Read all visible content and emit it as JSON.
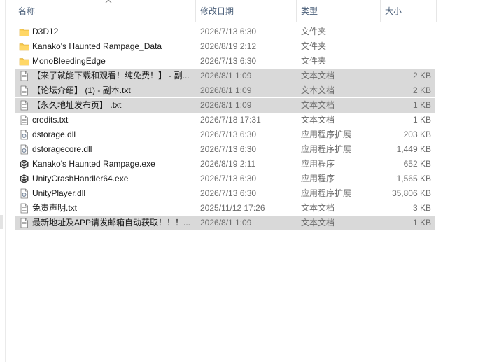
{
  "columns": {
    "name": "名称",
    "date": "修改日期",
    "type": "类型",
    "size": "大小"
  },
  "files": [
    {
      "name": "D3D12",
      "date": "2026/7/13 6:30",
      "type": "文件夹",
      "size": "",
      "icon": "folder-icon",
      "selected": false
    },
    {
      "name": "Kanako's Haunted Rampage_Data",
      "date": "2026/8/19 2:12",
      "type": "文件夹",
      "size": "",
      "icon": "folder-icon",
      "selected": false
    },
    {
      "name": "MonoBleedingEdge",
      "date": "2026/7/13 6:30",
      "type": "文件夹",
      "size": "",
      "icon": "folder-icon",
      "selected": false
    },
    {
      "name": "【来了就能下载和观看！纯免费！】 - 副...",
      "date": "2026/8/1 1:09",
      "type": "文本文档",
      "size": "2 KB",
      "icon": "text-file-icon",
      "selected": true
    },
    {
      "name": "【论坛介绍】 (1) - 副本.txt",
      "date": "2026/8/1 1:09",
      "type": "文本文档",
      "size": "2 KB",
      "icon": "text-file-icon",
      "selected": true
    },
    {
      "name": "【永久地址发布页】 .txt",
      "date": "2026/8/1 1:09",
      "type": "文本文档",
      "size": "1 KB",
      "icon": "text-file-icon",
      "selected": true
    },
    {
      "name": "credits.txt",
      "date": "2026/7/18 17:31",
      "type": "文本文档",
      "size": "1 KB",
      "icon": "text-file-icon",
      "selected": false
    },
    {
      "name": "dstorage.dll",
      "date": "2026/7/13 6:30",
      "type": "应用程序扩展",
      "size": "203 KB",
      "icon": "dll-file-icon",
      "selected": false
    },
    {
      "name": "dstoragecore.dll",
      "date": "2026/7/13 6:30",
      "type": "应用程序扩展",
      "size": "1,449 KB",
      "icon": "dll-file-icon",
      "selected": false
    },
    {
      "name": "Kanako's Haunted Rampage.exe",
      "date": "2026/8/19 2:11",
      "type": "应用程序",
      "size": "652 KB",
      "icon": "unity-icon",
      "selected": false
    },
    {
      "name": "UnityCrashHandler64.exe",
      "date": "2026/7/13 6:30",
      "type": "应用程序",
      "size": "1,565 KB",
      "icon": "unity-icon",
      "selected": false
    },
    {
      "name": "UnityPlayer.dll",
      "date": "2026/7/13 6:30",
      "type": "应用程序扩展",
      "size": "35,806 KB",
      "icon": "dll-file-icon",
      "selected": false
    },
    {
      "name": "免责声明.txt",
      "date": "2025/11/12 17:26",
      "type": "文本文档",
      "size": "3 KB",
      "icon": "text-file-icon",
      "selected": false
    },
    {
      "name": "最新地址及APP请发邮箱自动获取！！！...",
      "date": "2026/8/1 1:09",
      "type": "文本文档",
      "size": "1 KB",
      "icon": "text-file-icon",
      "selected": true
    }
  ]
}
